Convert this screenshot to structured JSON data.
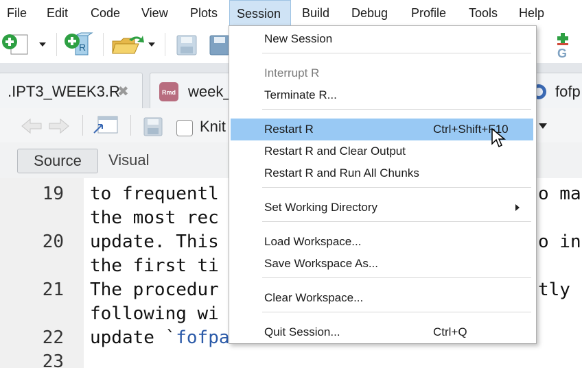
{
  "menubar": {
    "items": [
      {
        "label": "File"
      },
      {
        "label": "Edit"
      },
      {
        "label": "Code"
      },
      {
        "label": "View"
      },
      {
        "label": "Plots"
      },
      {
        "label": "Session"
      },
      {
        "label": "Build"
      },
      {
        "label": "Debug"
      },
      {
        "label": "Profile"
      },
      {
        "label": "Tools"
      },
      {
        "label": "Help"
      }
    ]
  },
  "tabs": {
    "tab1": {
      "label": ".IPT3_WEEK3.R",
      "close": "✖"
    },
    "tab2": {
      "label": "week_",
      "icon_text": "Rmd"
    },
    "tab3": {
      "label": "fofp"
    }
  },
  "editor_toolbar": {
    "knit_label": "Knit"
  },
  "source_bar": {
    "source_label": "Source",
    "visual_label": "Visual"
  },
  "editor": {
    "lines": [
      {
        "num": "19",
        "text": "to frequentl"
      },
      {
        "num": "",
        "text": "the most rec"
      },
      {
        "num": "20",
        "text": "update. This"
      },
      {
        "num": "",
        "text": "the first ti"
      },
      {
        "num": "21",
        "text": "The procedur"
      },
      {
        "num": "",
        "text": "following wi"
      },
      {
        "num": "22",
        "text": "update `fofpack` to the latest available"
      },
      {
        "num": "23",
        "text": ""
      }
    ],
    "right_fragments": {
      "r1": "o ma",
      "r2": "o in",
      "r3": "tly"
    }
  },
  "session_menu": {
    "new_session": "New Session",
    "interrupt": "Interrupt R",
    "terminate": "Terminate R...",
    "restart": "Restart R",
    "restart_shortcut": "Ctrl+Shift+F10",
    "restart_clear": "Restart R and Clear Output",
    "restart_run": "Restart R and Run All Chunks",
    "set_wd": "Set Working Directory",
    "load_ws": "Load Workspace...",
    "save_ws": "Save Workspace As...",
    "clear_ws": "Clear Workspace...",
    "quit": "Quit Session...",
    "quit_shortcut": "Ctrl+Q"
  },
  "colors": {
    "accent_highlight": "#99c9f4",
    "menu_active": "#cfe3f5",
    "code_keyword": "#2b5aa8"
  }
}
